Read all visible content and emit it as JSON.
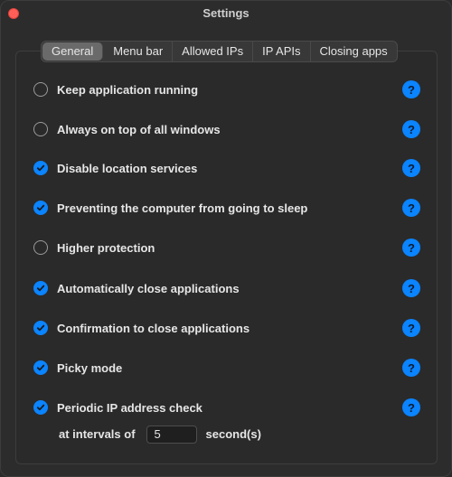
{
  "window": {
    "title": "Settings"
  },
  "tabs": [
    {
      "label": "General",
      "active": true
    },
    {
      "label": "Menu bar",
      "active": false
    },
    {
      "label": "Allowed IPs",
      "active": false
    },
    {
      "label": "IP APIs",
      "active": false
    },
    {
      "label": "Closing apps",
      "active": false
    }
  ],
  "options": [
    {
      "label": "Keep application running",
      "checked": false
    },
    {
      "label": "Always on top of all windows",
      "checked": false
    },
    {
      "label": "Disable location services",
      "checked": true
    },
    {
      "label": "Preventing the computer from going to sleep",
      "checked": true
    },
    {
      "label": "Higher protection",
      "checked": false
    },
    {
      "label": "Automatically close applications",
      "checked": true
    },
    {
      "label": "Confirmation to close applications",
      "checked": true
    },
    {
      "label": "Picky mode",
      "checked": true
    },
    {
      "label": "Periodic IP address check",
      "checked": true
    }
  ],
  "help": {
    "glyph": "?"
  },
  "interval": {
    "prefix": "at intervals of",
    "value": "5",
    "suffix": "second(s)"
  },
  "colors": {
    "accent": "#0a84ff",
    "close": "#ff5f57"
  }
}
